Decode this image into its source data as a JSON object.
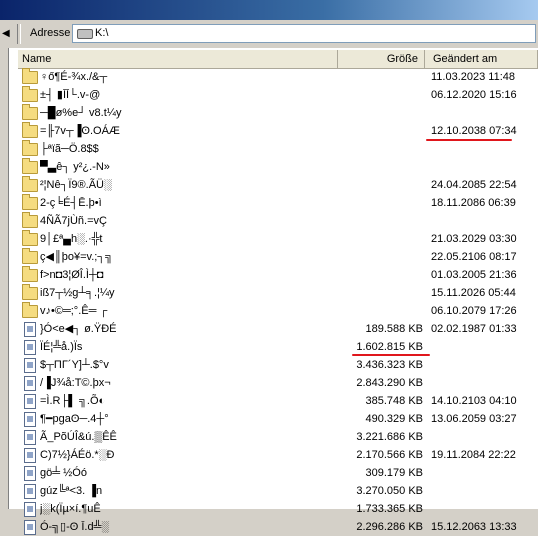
{
  "address": {
    "label": "Adresse",
    "value": "K:\\"
  },
  "columns": {
    "name": "Name",
    "size": "Größe",
    "date": "Geändert am"
  },
  "rows": [
    {
      "type": "folder",
      "name": "♀ő¶É-¾x./&┬",
      "size": "",
      "date": "11.03.2023 11:48"
    },
    {
      "type": "folder",
      "name": "±┤ ▮ĪĪ└.v-@",
      "size": "",
      "date": "06.12.2020 15:16"
    },
    {
      "type": "folder",
      "name": "─█ø%e┘ v8.t¼y",
      "size": "",
      "date": ""
    },
    {
      "type": "folder",
      "name": "=╟7v┬▐ʘ.OÁÆ",
      "size": "",
      "date": "12.10.2038 07:34"
    },
    {
      "type": "folder",
      "name": "├ªïã─Ö.8$$",
      "size": "",
      "date": ""
    },
    {
      "type": "folder",
      "name": "▀▃ê┐ y²¿.-N»",
      "size": "",
      "date": ""
    },
    {
      "type": "folder",
      "name": "²¦Nê┐Ï9®.ÃÜ░",
      "size": "",
      "date": "24.04.2085 22:54"
    },
    {
      "type": "folder",
      "name": "2-ç╘É┤Ē.þ•ì",
      "size": "",
      "date": "18.11.2086 06:39"
    },
    {
      "type": "folder",
      "name": "4ÑÃ7jÙñ.=vÇ",
      "size": "",
      "date": ""
    },
    {
      "type": "folder",
      "name": "9│£ª▄h░.·╬t",
      "size": "",
      "date": "21.03.2029 03:30"
    },
    {
      "type": "folder",
      "name": "ç◀║þo¥=v.;┐╗",
      "size": "",
      "date": "22.05.2106 08:17"
    },
    {
      "type": "folder",
      "name": "f>n◘3¦ØÎ.Ì┼◘",
      "size": "",
      "date": "01.03.2005 21:36"
    },
    {
      "type": "folder",
      "name": "iß7┬½g┴╕.¦¼y",
      "size": "",
      "date": "15.11.2026 05:44"
    },
    {
      "type": "folder",
      "name": "v♪•©═;°.Ê═ ┌",
      "size": "",
      "date": "06.10.2079 17:26"
    },
    {
      "type": "file",
      "name": "}Ó<e◀┐ ø.ŸÐÉ",
      "size": "189.588 KB",
      "date": "02.02.1987 01:33"
    },
    {
      "type": "file",
      "name": "ÏÉ¦╩å.)Ïs",
      "size": "1.602.815 KB",
      "date": ""
    },
    {
      "type": "file",
      "name": "$┬ΠΓ´Y]┴.$°v",
      "size": "3.436.323 KB",
      "date": ""
    },
    {
      "type": "file",
      "name": "/▐J¾å:T©.þx¬",
      "size": "2.843.290 KB",
      "date": ""
    },
    {
      "type": "file",
      "name": "=Ì.R├▌ ╗.Õ◐",
      "size": "385.748 KB",
      "date": "14.10.2103 04:10"
    },
    {
      "type": "file",
      "name": "¶━pgaʘ─.4┼°",
      "size": "490.329 KB",
      "date": "13.06.2059 03:27"
    },
    {
      "type": "file",
      "name": "Ã_PõÚÎ&ú.▒ÊÊ",
      "size": "3.221.686 KB",
      "date": ""
    },
    {
      "type": "file",
      "name": "C)7½}ÁÉö.*░Ð",
      "size": "2.170.566 KB",
      "date": "19.11.2084 22:22"
    },
    {
      "type": "file",
      "name": "gö╧ ½Óó",
      "size": "309.179 KB",
      "date": ""
    },
    {
      "type": "file",
      "name": "gúz╚ª<3. ▐n",
      "size": "3.270.050 KB",
      "date": ""
    },
    {
      "type": "file",
      "name": "j░k(Ïµ×í.¶uÊ",
      "size": "1.733.365 KB",
      "date": ""
    },
    {
      "type": "file",
      "name": "Ó-╗▯-ʘ Ī.d╩░",
      "size": "2.296.286 KB",
      "date": "15.12.2063 13:33"
    }
  ],
  "colors": {
    "highlight_underline": "#e0161c",
    "folder": "#f5dc80"
  }
}
